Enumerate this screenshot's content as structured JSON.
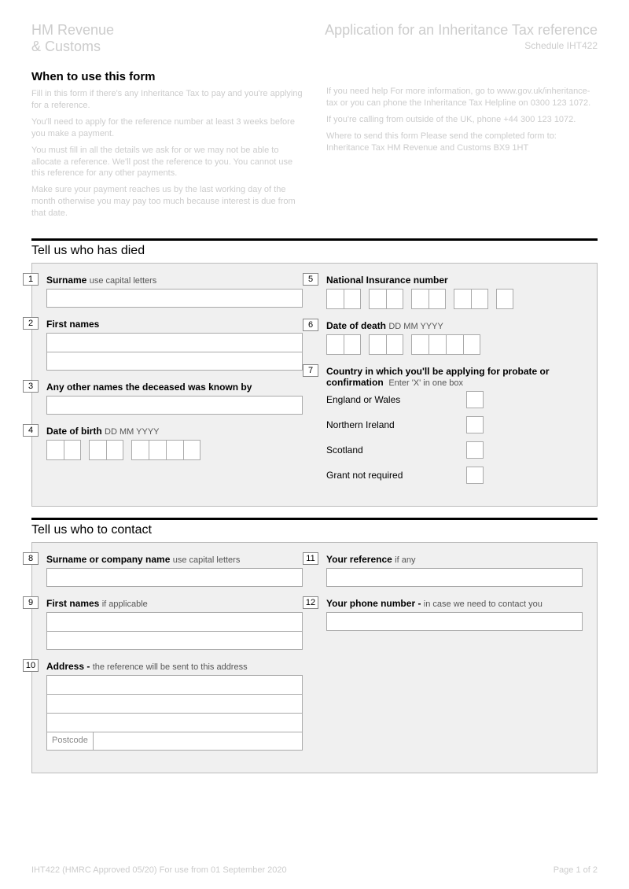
{
  "header": {
    "logo_line1": "HM Revenue",
    "logo_line2": "& Customs",
    "title": "Application for an Inheritance Tax reference",
    "subtitle": "Schedule IHT422"
  },
  "intro": {
    "heading": "When to use this form",
    "left_p1": "Fill in this form if there's any Inheritance Tax to pay and you're applying for a reference.",
    "left_p2": "You'll need to apply for the reference number at least 3 weeks before you make a payment.",
    "left_p3": "You must fill in all the details we ask for or we may not be able to allocate a reference. We'll post the reference to you. You cannot use this reference for any other payments.",
    "left_p4": "Make sure your payment reaches us by the last working day of the month otherwise you may pay too much because interest is due from that date.",
    "right_p1": "If you need help\nFor more information, go to www.gov.uk/inheritance-tax or you can phone the Inheritance Tax Helpline on\n0300 123 1072.",
    "right_p2": "If you're calling from outside of the UK, phone +44 300 123 1072.",
    "right_p3": "Where to send this form\nPlease send the completed form to:\nInheritance Tax\nHM Revenue and Customs\nBX9 1HT"
  },
  "section1": {
    "title": "Tell us who has died",
    "f1_num": "1",
    "f1_label": "Surname",
    "f1_hint": "use capital letters",
    "f2_num": "2",
    "f2_label": "First names",
    "f3_num": "3",
    "f3_label": "Any other names the deceased was known by",
    "f4_num": "4",
    "f4_label": "Date of birth",
    "f4_hint": "DD MM YYYY",
    "f5_num": "5",
    "f5_label": "National Insurance number",
    "f6_num": "6",
    "f6_label": "Date of death",
    "f6_hint": "DD MM YYYY",
    "f7_num": "7",
    "f7_label": "Country in which you'll be applying for probate or confirmation",
    "f7_hint": "Enter 'X' in one box",
    "f7_opt1": "England or Wales",
    "f7_opt2": "Northern Ireland",
    "f7_opt3": "Scotland",
    "f7_opt4": "Grant not required"
  },
  "section2": {
    "title": "Tell us who to contact",
    "f8_num": "8",
    "f8_label": "Surname or company name",
    "f8_hint": "use capital letters",
    "f9_num": "9",
    "f9_label": "First names",
    "f9_hint": "if applicable",
    "f10_num": "10",
    "f10_label": "Address -",
    "f10_hint": "the reference will be sent to this address",
    "f10_postcode": "Postcode",
    "f11_num": "11",
    "f11_label": "Your reference",
    "f11_hint": "if any",
    "f12_num": "12",
    "f12_label": "Your phone number -",
    "f12_hint": "in case we need to contact you"
  },
  "footer": {
    "left": "IHT422 (HMRC Approved 05/20) For use from 01 September 2020",
    "right": "Page 1 of 2"
  }
}
